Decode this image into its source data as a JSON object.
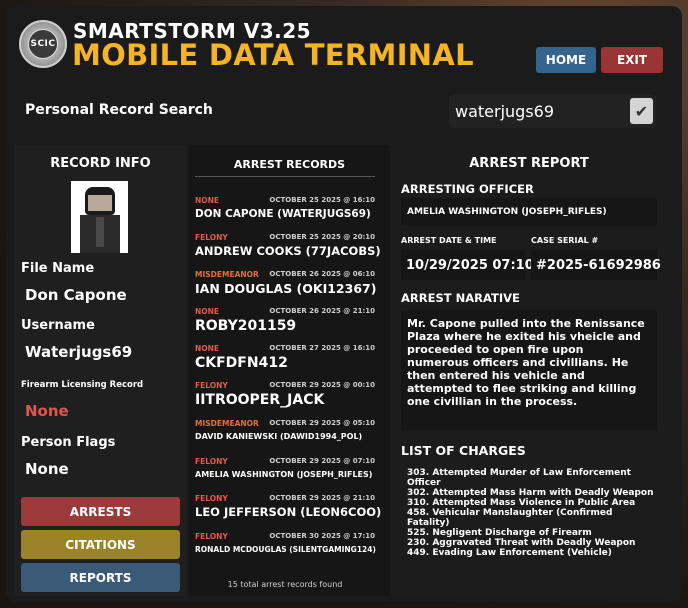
{
  "header": {
    "logo_text": "SCIC",
    "version": "SMARTSTORM V3.25",
    "title": "MOBILE DATA TERMINAL",
    "home_label": "HOME",
    "exit_label": "EXIT"
  },
  "search": {
    "label": "Personal Record Search",
    "value": "waterjugs69",
    "checkbox_glyph": "✔"
  },
  "record_info": {
    "heading": "RECORD INFO",
    "file_name_label": "File Name",
    "file_name": "Don Capone",
    "username_label": "Username",
    "username": "Waterjugs69",
    "firearm_label": "Firearm Licensing Record",
    "firearm_value": "None",
    "flags_label": "Person Flags",
    "flags_value": "None",
    "buttons": {
      "arrests": "ARRESTS",
      "citations": "CITATIONS",
      "reports": "REPORTS"
    }
  },
  "arrest_records": {
    "heading": "ARREST RECORDS",
    "items": [
      {
        "type": "NONE",
        "date": "OCTOBER 25 2025 @ 16:10",
        "name": "DON CAPONE (WATERJUGS69)"
      },
      {
        "type": "FELONY",
        "date": "OCTOBER 25 2025 @ 20:10",
        "name": "ANDREW COOKS (77JACOBS)"
      },
      {
        "type": "MISDEMEANOR",
        "date": "OCTOBER 26 2025 @ 06:10",
        "name": "IAN DOUGLAS (OKI12367)"
      },
      {
        "type": "NONE",
        "date": "OCTOBER 26 2025 @ 21:10",
        "name": "ROBY201159"
      },
      {
        "type": "NONE",
        "date": "OCTOBER 27 2025 @ 16:10",
        "name": "CKFDFN412"
      },
      {
        "type": "FELONY",
        "date": "OCTOBER 29 2025 @ 00:10",
        "name": "IITROOPER_JACK"
      },
      {
        "type": "MISDEMEANOR",
        "date": "OCTOBER 29 2025 @ 05:10",
        "name": "DAVID KANIEWSKI (DAWID1994_POL)"
      },
      {
        "type": "FELONY",
        "date": "OCTOBER 29 2025 @ 07:10",
        "name": "AMELIA WASHINGTON (JOSEPH_RIFLES)"
      },
      {
        "type": "FELONY",
        "date": "OCTOBER 29 2025 @ 21:10",
        "name": "LEO JEFFERSON (LEON6COO)"
      },
      {
        "type": "FELONY",
        "date": "OCTOBER 30 2025 @ 17:10",
        "name": "RONALD MCDOUGLAS (SILENTGAMING124)"
      }
    ],
    "total_text": "15 total arrest records found"
  },
  "arrest_report": {
    "heading": "ARREST REPORT",
    "officer_label": "ARRESTING OFFICER",
    "officer": "AMELIA WASHINGTON (JOSEPH_RIFLES)",
    "date_label": "ARREST DATE & TIME",
    "date": "10/29/2025 07:10",
    "serial_label": "CASE SERIAL #",
    "serial": "#2025-61692986",
    "narrative_label": "ARREST NARATIVE",
    "narrative": "Mr. Capone pulled into the Renissance Plaza where he exited his vheicle and proceeded to open fire upon numerous officers and civillians. He then entered his vehicle and attempted to flee striking and killing one civillian in the process.",
    "charges_label": "LIST OF CHARGES",
    "charges": [
      "303. Attempted Murder of Law Enforcement Officer",
      "302. Attempted Mass Harm with Deadly Weapon",
      "310. Attempted Mass Violence in Public Area",
      "458. Vehicular Manslaughter (Confirmed Fatality)",
      "525. Negligent Discharge of Firearm",
      "230. Aggravated Threat with Deadly Weapon",
      "449. Evading Law Enforcement (Vehicle)"
    ]
  },
  "colors": {
    "accent_yellow": "#f5b326",
    "home_blue": "#35648f",
    "exit_red": "#9b3434",
    "arrests_btn": "#9b3a3a",
    "citations_btn": "#9a8329",
    "reports_btn": "#3a5a78",
    "type_none": "#e25a4a",
    "type_felony": "#e25a4a",
    "type_misdemeanor": "#e0703a",
    "firearm_none": "#e2574a"
  }
}
